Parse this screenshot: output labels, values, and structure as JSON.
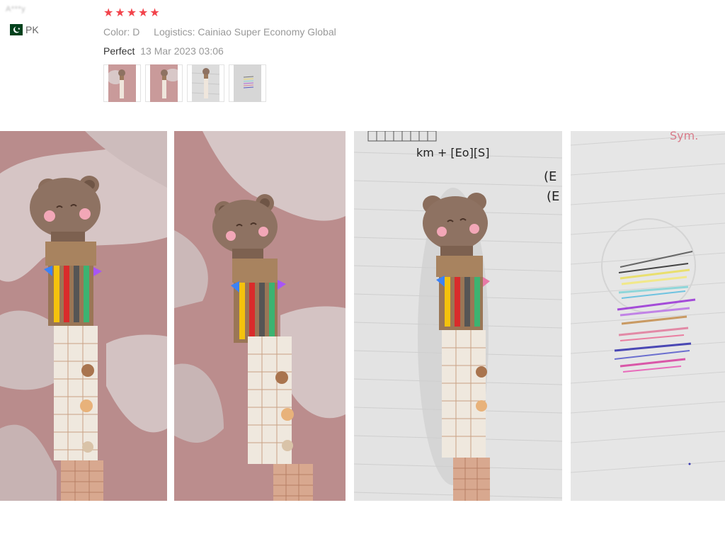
{
  "reviewer": {
    "name": "A***y",
    "country_code": "PK",
    "flag_icon": "pakistan-flag-icon"
  },
  "review": {
    "rating": 5,
    "stars": [
      "★",
      "★",
      "★",
      "★",
      "★"
    ],
    "color_label": "Color:",
    "color_value": "D",
    "logistics_label": "Logistics:",
    "logistics_value": "Cainiao Super Economy Global",
    "comment": "Perfect",
    "date": "13 Mar 2023 03:06"
  },
  "colors": {
    "star": "#f2434b",
    "pakistan_green": "#01411c"
  },
  "photos": [
    {
      "name": "photo-bear-pen-on-rug",
      "subject": "bear-pen-on-pink-rug"
    },
    {
      "name": "photo-bear-pen-on-rug-2",
      "subject": "bear-pen-on-pink-rug"
    },
    {
      "name": "photo-bear-pen-on-notebook",
      "subject": "bear-pen-on-notebook"
    },
    {
      "name": "photo-ink-color-samples",
      "subject": "ink-swatches-on-paper"
    }
  ]
}
